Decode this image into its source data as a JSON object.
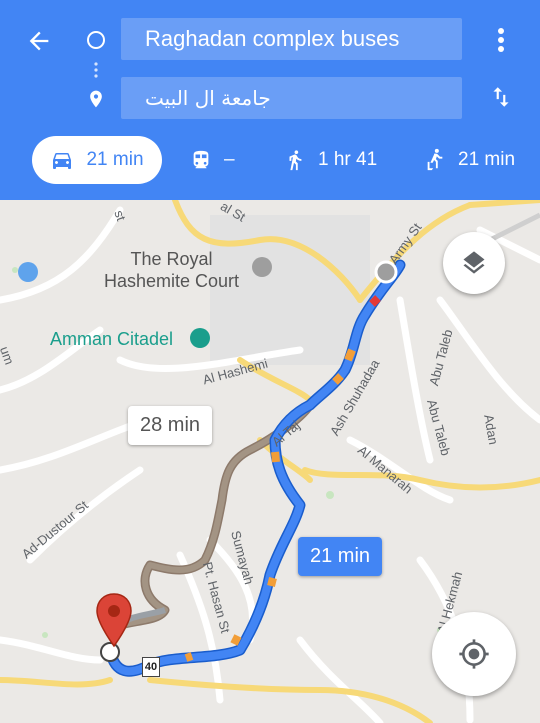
{
  "header": {
    "origin": "Raghadan complex buses",
    "destination": "جامعة ال البيت"
  },
  "modes": [
    {
      "name": "driving",
      "label": "21 min",
      "selected": true
    },
    {
      "name": "transit",
      "label": "–"
    },
    {
      "name": "walking",
      "label": "1 hr 41"
    },
    {
      "name": "ride",
      "label": "21 min"
    }
  ],
  "map": {
    "places": {
      "royal_court": "The Royal\nHashemite Court",
      "citadel": "Amman Citadel"
    },
    "streets": {
      "army_st": "Army St",
      "hashemi": "Al Hashemi",
      "al_taj": "Al Taj",
      "ash_shuhadaa": "Ash Shuhadaa",
      "abu_taleb_1": "Abu Taleb",
      "abu_taleb_2": "Abu Taleb",
      "adan": "Adan",
      "al_manarah": "Al Manarah",
      "ad_dustour": "Ad-Dustour St",
      "sumayah": "Sumayah",
      "pt_hasan": "Pt. Hasan St",
      "al_hekmah": "Al Hekmah",
      "al_st_top": "al St",
      "st_left_top": "st",
      "um_left": "um",
      "road_40": "40"
    },
    "route_labels": {
      "alternate": "28 min",
      "main": "21 min"
    }
  },
  "colors": {
    "header_bg": "#4285f4",
    "route_main": "#4285f4",
    "route_alt": "#a09082",
    "marker": "#db4437"
  }
}
